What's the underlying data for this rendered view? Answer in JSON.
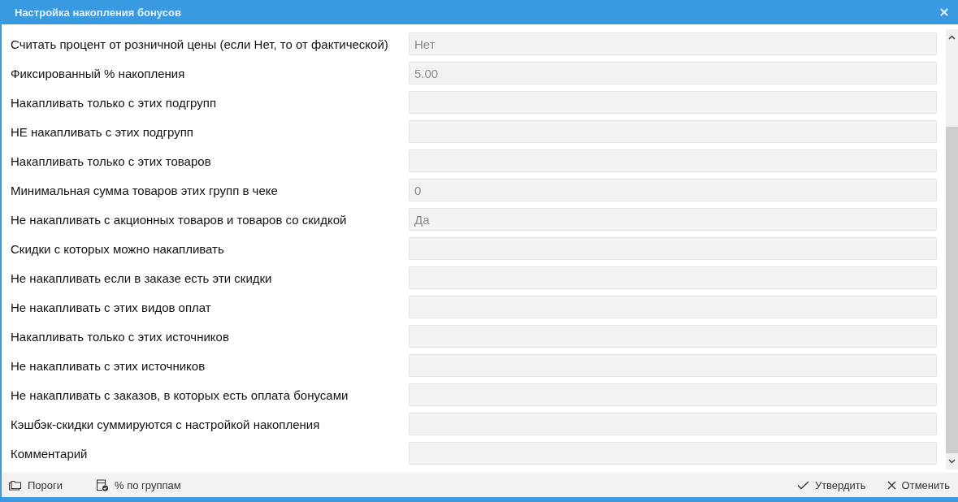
{
  "window": {
    "title": "Настройка накопления бонусов"
  },
  "settings": [
    {
      "label": "Считать процент от розничной цены (если Нет, то от фактической)",
      "value": "Нет",
      "disabled": true
    },
    {
      "label": "Фиксированный % накопления",
      "value": "5.00",
      "disabled": true
    },
    {
      "label": "Накапливать только с этих подгрупп",
      "disabled": true
    },
    {
      "label": "НЕ накапливать с этих подгрупп",
      "disabled": true
    },
    {
      "label": "Накапливать только с этих товаров",
      "disabled": true
    },
    {
      "label": "Минимальная сумма товаров этих групп в чеке",
      "value": "0",
      "disabled": true
    },
    {
      "label": "Не накапливать с акционных товаров и товаров со скидкой",
      "value": "Да",
      "disabled": true
    },
    {
      "label": "Скидки с которых можно накапливать",
      "disabled": true
    },
    {
      "label": "Не накапливать если в заказе есть эти скидки",
      "disabled": true
    },
    {
      "label": "Не накапливать с этих видов оплат",
      "disabled": true
    },
    {
      "label": "Накапливать только с этих источников",
      "disabled": true
    },
    {
      "label": "Не накапливать с этих источников",
      "disabled": true
    },
    {
      "label": "Не накапливать с заказов, в которых есть оплата бонусами",
      "disabled": true
    },
    {
      "label": "Кэшбэк-скидки суммируются с настройкой накопления",
      "disabled": true
    },
    {
      "label": "Комментарий",
      "disabled": true
    }
  ],
  "footer": {
    "left_buttons": [
      {
        "label": "Пороги",
        "kind": "folders"
      },
      {
        "label": "% по группам",
        "kind": "box-check"
      }
    ],
    "right_buttons": [
      {
        "label": "Утвердить",
        "kind": "check"
      },
      {
        "label": "Отменить",
        "kind": "cross"
      }
    ]
  }
}
